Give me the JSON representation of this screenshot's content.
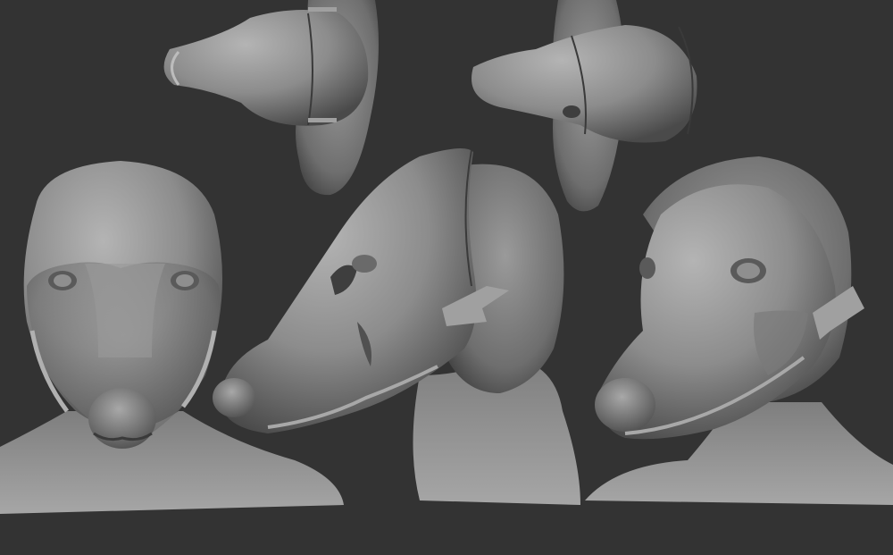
{
  "scene": {
    "background_color": "#333333",
    "clay_color": "#8c8c8c",
    "clay_shadow_color": "#4a4a4a",
    "clay_highlight_color": "#b4b4b4",
    "strap_color": "#a0a0a0",
    "views": [
      {
        "id": "top-view-left",
        "subject": "mask-on-head-top-view"
      },
      {
        "id": "top-view-right",
        "subject": "mask-on-head-top-view"
      },
      {
        "id": "front-view",
        "subject": "mask-on-head-front-view"
      },
      {
        "id": "side-view",
        "subject": "mask-on-head-side-view"
      },
      {
        "id": "three-quarter-view",
        "subject": "mask-on-head-three-quarter-view"
      }
    ]
  }
}
